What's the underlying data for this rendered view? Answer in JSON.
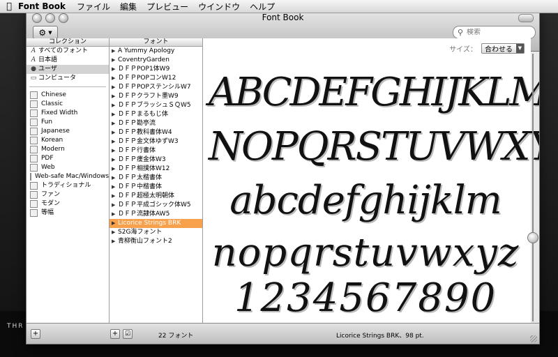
{
  "menubar": {
    "app_name": "Font Book",
    "items": [
      "ファイル",
      "編集",
      "プレビュー",
      "ウインドウ",
      "ヘルプ"
    ]
  },
  "window": {
    "title": "Font Book",
    "search_placeholder": "検索"
  },
  "collections": {
    "header": "コレクション",
    "special": [
      {
        "label": "すべてのフォント",
        "icon": "font-icon"
      },
      {
        "label": "日本語",
        "icon": "font-icon"
      },
      {
        "label": "ユーザ",
        "icon": "user-icon"
      },
      {
        "label": "コンピュータ",
        "icon": "computer-icon"
      }
    ],
    "items": [
      "Chinese",
      "Classic",
      "Fixed Width",
      "Fun",
      "Japanese",
      "Korean",
      "Modern",
      "PDF",
      "Web",
      "Web-safe Mac/Windows",
      "トラディショナル",
      "ファン",
      "モダン",
      "等幅"
    ],
    "selected_index": 2
  },
  "fonts": {
    "header": "フォント",
    "items": [
      "A Yummy Apology",
      "CoventryGarden",
      "ＤＦＰPOP1体W9",
      "ＤＦＰPOPコンW12",
      "ＤＦＰPOPステンシルW7",
      "ＤＦＰクラフト墨W9",
      "ＤＦＰブラッシュＳＱW5",
      "ＤＦＰまるもじ体",
      "ＤＦＰ勘亭流",
      "ＤＦＰ教科書体W4",
      "ＤＦＰ金文体ゆずW3",
      "ＤＦＰ行書体",
      "ＤＦＰ痩金体W3",
      "ＤＦＰ相撲体W12",
      "ＤＦＰ太楷書体",
      "ＤＦＰ中楷書体",
      "ＤＦＰ超極太明朝体",
      "ＤＦＰ平成ゴシック体W5",
      "ＤＦＰ流隷体AW5",
      "Licorice Strings BRK",
      "S2G海フォント",
      "青柳衡山フォント2"
    ],
    "selected_index": 19
  },
  "preview": {
    "size_label": "サイズ：",
    "size_value": "合わせる",
    "lines": [
      "ABCDEFGHIJKLM",
      "NOPQRSTUVWXYZ",
      "abcdefghijklm",
      "nopqrstuvwxyz",
      "1234567890"
    ]
  },
  "bottombar": {
    "add_label": "+",
    "font_count": "22 フォント",
    "status": "Licorice Strings BRK、98 pt."
  },
  "desktop": {
    "text": "THR"
  }
}
